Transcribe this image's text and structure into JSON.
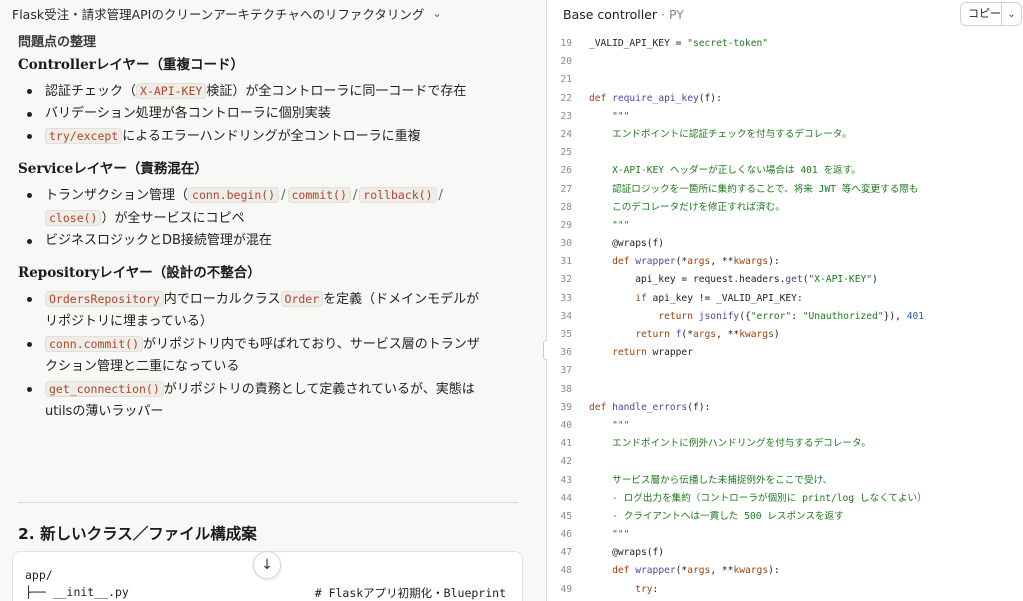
{
  "chat": {
    "title": "Flask受注・請求管理APIのクリーンアーキテクチャへのリファクタリング",
    "section_heading": "問題点の整理",
    "groups": [
      {
        "heading": "Controllerレイヤー（重複コード）",
        "items": [
          [
            {
              "t": "text",
              "v": "認証チェック（"
            },
            {
              "t": "code",
              "v": "X-API-KEY"
            },
            {
              "t": "text",
              "v": "検証）が全コントローラに同一コードで存在"
            }
          ],
          [
            {
              "t": "text",
              "v": "バリデーション処理が各コントローラに個別実装"
            }
          ],
          [
            {
              "t": "code",
              "v": "try/except"
            },
            {
              "t": "text",
              "v": "によるエラーハンドリングが全コントローラに重複"
            }
          ]
        ]
      },
      {
        "heading": "Serviceレイヤー（責務混在）",
        "items": [
          [
            {
              "t": "text",
              "v": "トランザクション管理（"
            },
            {
              "t": "code",
              "v": "conn.begin()"
            },
            {
              "t": "sep",
              "v": "/"
            },
            {
              "t": "code",
              "v": "commit()"
            },
            {
              "t": "sep",
              "v": "/"
            },
            {
              "t": "code",
              "v": "rollback()"
            },
            {
              "t": "sep",
              "v": "/"
            },
            {
              "t": "br"
            },
            {
              "t": "code",
              "v": "close()"
            },
            {
              "t": "text",
              "v": "）が全サービスにコピペ"
            }
          ],
          [
            {
              "t": "text",
              "v": "ビジネスロジックとDB接続管理が混在"
            }
          ]
        ]
      },
      {
        "heading": "Repositoryレイヤー（設計の不整合）",
        "items": [
          [
            {
              "t": "code",
              "v": "OrdersRepository"
            },
            {
              "t": "text",
              "v": "内でローカルクラス"
            },
            {
              "t": "code",
              "v": "Order"
            },
            {
              "t": "text",
              "v": "を定義（ドメインモデルが"
            },
            {
              "t": "br"
            },
            {
              "t": "text",
              "v": "リポジトリに埋まっている）"
            }
          ],
          [
            {
              "t": "code",
              "v": "conn.commit()"
            },
            {
              "t": "text",
              "v": "がリポジトリ内でも呼ばれており、サービス層のトランザ"
            },
            {
              "t": "br"
            },
            {
              "t": "text",
              "v": "クション管理と二重になっている"
            }
          ],
          [
            {
              "t": "code",
              "v": "get_connection()"
            },
            {
              "t": "text",
              "v": "がリポジトリの責務として定義されているが、実態は"
            },
            {
              "t": "br"
            },
            {
              "t": "text",
              "v": "utilsの薄いラッパー"
            }
          ]
        ]
      }
    ],
    "h2": "2. 新しいクラス／ファイル構成案",
    "codebox": {
      "line1": "app/",
      "line2": "├── __init__.py",
      "comment": "# Flaskアプリ初期化・Blueprint"
    }
  },
  "artifact": {
    "title": "Base controller",
    "type": "PY",
    "copy_label": "コピー",
    "lines": [
      {
        "n": "19",
        "h": [
          [
            "",
            "_VALID_API_KEY = "
          ],
          [
            "s",
            "\"secret-token\""
          ]
        ]
      },
      {
        "n": "20",
        "h": []
      },
      {
        "n": "21",
        "h": []
      },
      {
        "n": "22",
        "h": [
          [
            "k",
            "def "
          ],
          [
            "f",
            "require_api_key"
          ],
          [
            "",
            "(f):"
          ]
        ]
      },
      {
        "n": "23",
        "h": [
          [
            "d",
            "    \"\"\""
          ]
        ]
      },
      {
        "n": "24",
        "h": [
          [
            "d",
            "    エンドポイントに認証チェックを付与するデコレータ。"
          ]
        ]
      },
      {
        "n": "25",
        "h": []
      },
      {
        "n": "26",
        "h": [
          [
            "d",
            "    X-API-KEY ヘッダーが正しくない場合は 401 を返す。"
          ]
        ]
      },
      {
        "n": "27",
        "h": [
          [
            "d",
            "    認証ロジックを一箇所に集約することで、将来 JWT 等へ変更する際も"
          ]
        ]
      },
      {
        "n": "28",
        "h": [
          [
            "d",
            "    このデコレータだけを修正すれば済む。"
          ]
        ]
      },
      {
        "n": "29",
        "h": [
          [
            "d",
            "    \"\"\""
          ]
        ]
      },
      {
        "n": "30",
        "h": [
          [
            "",
            "    @wraps(f)"
          ]
        ]
      },
      {
        "n": "31",
        "h": [
          [
            "k",
            "    def "
          ],
          [
            "f",
            "wrapper"
          ],
          [
            "",
            "(*"
          ],
          [
            "k",
            "args"
          ],
          [
            "",
            ", **"
          ],
          [
            "k",
            "kwargs"
          ],
          [
            "",
            "):"
          ]
        ]
      },
      {
        "n": "32",
        "h": [
          [
            "",
            "        api_key = request.headers."
          ],
          [
            "f",
            "get"
          ],
          [
            "",
            "("
          ],
          [
            "s",
            "\"X-API-KEY\""
          ],
          [
            "",
            ")"
          ]
        ]
      },
      {
        "n": "33",
        "h": [
          [
            "k",
            "        if "
          ],
          [
            "",
            "api_key != _VALID_API_KEY:"
          ]
        ]
      },
      {
        "n": "34",
        "h": [
          [
            "k",
            "            return "
          ],
          [
            "f",
            "jsonify"
          ],
          [
            "",
            "({"
          ],
          [
            "s",
            "\"error\""
          ],
          [
            "",
            ": "
          ],
          [
            "s",
            "\"Unauthorized\""
          ],
          [
            "",
            "}), "
          ],
          [
            "nmb",
            "401"
          ]
        ]
      },
      {
        "n": "35",
        "h": [
          [
            "k",
            "        return "
          ],
          [
            "f",
            "f"
          ],
          [
            "",
            "(*"
          ],
          [
            "k",
            "args"
          ],
          [
            "",
            ", **"
          ],
          [
            "k",
            "kwargs"
          ],
          [
            "",
            ")"
          ]
        ]
      },
      {
        "n": "36",
        "h": [
          [
            "k",
            "    return "
          ],
          [
            "",
            "wrapper"
          ]
        ]
      },
      {
        "n": "37",
        "h": []
      },
      {
        "n": "38",
        "h": []
      },
      {
        "n": "39",
        "h": [
          [
            "k",
            "def "
          ],
          [
            "f",
            "handle_errors"
          ],
          [
            "",
            "(f):"
          ]
        ]
      },
      {
        "n": "40",
        "h": [
          [
            "d",
            "    \"\"\""
          ]
        ]
      },
      {
        "n": "41",
        "h": [
          [
            "d",
            "    エンドポイントに例外ハンドリングを付与するデコレータ。"
          ]
        ]
      },
      {
        "n": "42",
        "h": []
      },
      {
        "n": "43",
        "h": [
          [
            "d",
            "    サービス層から伝播した未捕捉例外をここで受け、"
          ]
        ]
      },
      {
        "n": "44",
        "h": [
          [
            "d",
            "    - ログ出力を集約（コントローラが個別に print/log しなくてよい）"
          ]
        ]
      },
      {
        "n": "45",
        "h": [
          [
            "d",
            "    - クライアントへは一貫した 500 レスポンスを返す"
          ]
        ]
      },
      {
        "n": "46",
        "h": [
          [
            "d",
            "    \"\"\""
          ]
        ]
      },
      {
        "n": "47",
        "h": [
          [
            "",
            "    @wraps(f)"
          ]
        ]
      },
      {
        "n": "48",
        "h": [
          [
            "k",
            "    def "
          ],
          [
            "f",
            "wrapper"
          ],
          [
            "",
            "(*"
          ],
          [
            "k",
            "args"
          ],
          [
            "",
            ", **"
          ],
          [
            "k",
            "kwargs"
          ],
          [
            "",
            "):"
          ]
        ]
      },
      {
        "n": "49",
        "h": [
          [
            "k",
            "        try"
          ],
          [
            "",
            ":"
          ]
        ]
      }
    ]
  },
  "icons": {
    "title_chevron": "chevron-down-icon",
    "scroll_down": "arrow-down-icon",
    "copy_chevron": "chevron-down-icon",
    "panel_handle": "resize-handle-icon"
  }
}
